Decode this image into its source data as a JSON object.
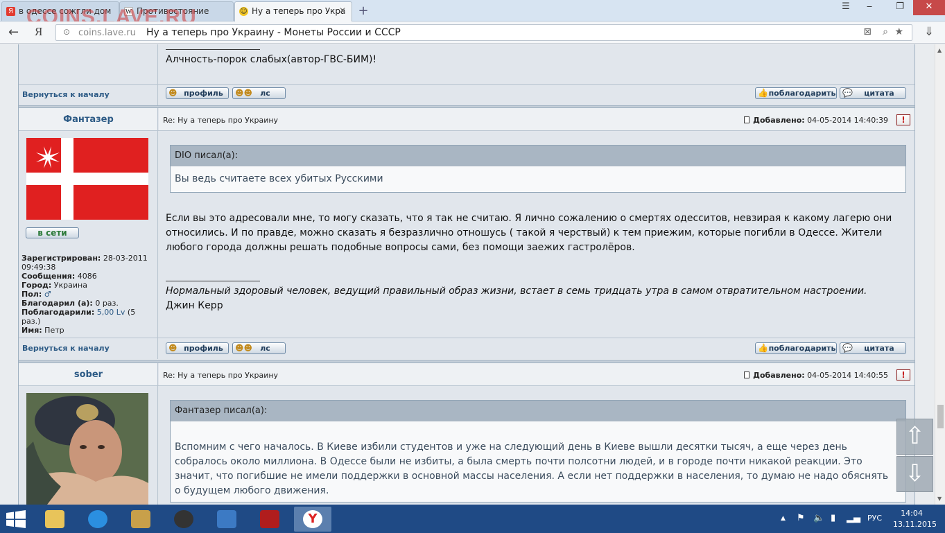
{
  "browser": {
    "tabs": [
      {
        "label": "в одессе сожгли дом",
        "favicon": "yandex-icon",
        "active": false
      },
      {
        "label": "Противостояние",
        "favicon": "wikipedia-icon",
        "active": false
      },
      {
        "label": "Ну а теперь про Укра",
        "favicon": "smiley-icon",
        "active": true
      }
    ],
    "brand_watermark": "COINS.LAVE.RU",
    "new_tab": "+",
    "address": {
      "domain": "coins.lave.ru",
      "title": "Ну а теперь про Украину - Монеты России и СССР"
    },
    "back_glyph": "←",
    "yandex_glyph": "Я"
  },
  "forum": {
    "back_to_top": "Вернуться к началу",
    "buttons": {
      "profile": "профиль",
      "pm": "лс",
      "thank": "поблагодарить",
      "quote": "цитата"
    },
    "added_label": "Добавлено:",
    "prev_post": {
      "signature": "Алчность-порок слабых(автор-ГВС-БИМ)!"
    },
    "posts": [
      {
        "author": "Фантазер",
        "subject": "Re: Ну а теперь про Украину",
        "added": "04-05-2014 14:40:39",
        "online": "в сети",
        "quote_head": "DIO писал(а):",
        "quote_body": "Вы ведь считаете всех убитых Русскими",
        "body": "Если вы это адресовали мне, то могу сказать, что я так не считаю. Я лично сожалению о смертях одесситов, невзирая к какому лагерю они относились. И по правде, можно сказать я безразлично отношусь ( такой я черствый) к тем приежим, которые погибли в Одессе. Жители любого города должны решать подобные вопросы сами, без помощи заежих гастролёров.",
        "signature_quote": "Нормальный здоровый человек, ведущий правильный образ жизни, встает в семь тридцать утра в самом отвратительном настроении.",
        "signature_author": "Джин Керр",
        "meta": {
          "registered_label": "Зарегистрирован:",
          "registered": "28-03-2011 09:49:38",
          "messages_label": "Сообщения:",
          "messages": "4086",
          "city_label": "Город:",
          "city": "Украина",
          "gender_label": "Пол:",
          "gender": "♂",
          "thanked_label": "Благодарил (а):",
          "thanked": "0 раз.",
          "thanks_label": "Поблагодарили:",
          "thanks_value": "5,00 Lv",
          "thanks_count": "(5 раз.)",
          "name_label": "Имя:",
          "name": "Петр"
        }
      },
      {
        "author": "sober",
        "subject": "Re: Ну а теперь про Украину",
        "added": "04-05-2014 14:40:55",
        "quote_head": "Фантазер писал(а):",
        "quote_body": "Вспомним с чего началось. В Киеве избили студентов и уже на следующий день в Киеве вышли десятки тысяч, а еще через день собралось около миллиона. В Одессе были не избиты, а была смерть почти полсотни людей, и в городе почти никакой реакции. Это значит, что погибшие не имели поддержки в основной массы населения. А если нет поддержки в населения, то думаю не надо обяснять о будущем любого движения."
      }
    ],
    "scroll_up": "⇧",
    "scroll_down": "⇩"
  },
  "taskbar": {
    "lang": "РУС",
    "time": "14:04",
    "date": "13.11.2015"
  },
  "colors": {
    "taskbar": "#1f4a85",
    "link": "#2c5a85",
    "quote_head": "#a9b6c3"
  }
}
